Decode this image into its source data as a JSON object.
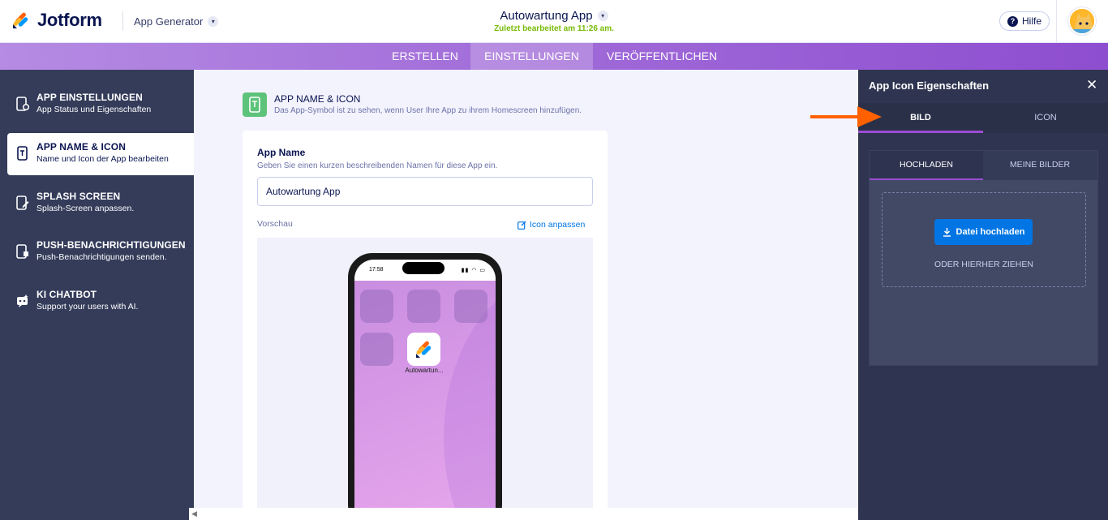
{
  "header": {
    "brand": "Jotform",
    "product": "App Generator",
    "app_title": "Autowartung App",
    "last_edited": "Zuletzt bearbeitet am 11:26 am.",
    "help_label": "Hilfe"
  },
  "nav": {
    "tabs": [
      {
        "label": "ERSTELLEN"
      },
      {
        "label": "EINSTELLUNGEN"
      },
      {
        "label": "VERÖFFENTLICHEN"
      }
    ],
    "active": "EINSTELLUNGEN"
  },
  "sidebar": {
    "items": [
      {
        "title": "APP EINSTELLUNGEN",
        "subtitle": "App Status und Eigenschaften"
      },
      {
        "title": "APP NAME & ICON",
        "subtitle": "Name und Icon der App bearbeiten"
      },
      {
        "title": "SPLASH SCREEN",
        "subtitle": "Splash-Screen anpassen."
      },
      {
        "title": "PUSH-BENACHRICHTIGUNGEN",
        "subtitle": "Push-Benachrichtigungen senden."
      },
      {
        "title": "KI CHATBOT",
        "subtitle": "Support your users with AI."
      }
    ],
    "active_index": 1
  },
  "main": {
    "section_title": "APP NAME & ICON",
    "section_subtitle": "Das App-Symbol ist zu sehen, wenn User Ihre App zu ihrem Homescreen hinzufügen.",
    "field_label": "App Name",
    "field_help": "Geben Sie einen kurzen beschreibenden Namen für diese App ein.",
    "field_value": "Autowartung App",
    "preview_label": "Vorschau",
    "customize_icon_label": "Icon anpassen",
    "phone": {
      "time": "17:58",
      "app_label": "Autowartun..."
    }
  },
  "panel": {
    "title": "App Icon Eigenschaften",
    "tabs": [
      {
        "label": "BILD"
      },
      {
        "label": "ICON"
      }
    ],
    "active_tab": "BILD",
    "inner_tabs": [
      {
        "label": "HOCHLADEN"
      },
      {
        "label": "MEINE BILDER"
      }
    ],
    "active_inner_tab": "HOCHLADEN",
    "upload_button": "Datei hochladen",
    "drag_text": "ODER HIERHER ZIEHEN"
  },
  "colors": {
    "accent_purple": "#9c4dd3",
    "primary_blue": "#0075e3",
    "sidebar_bg": "#343c5a",
    "panel_bg": "#2f3550",
    "annotation_orange": "#ff6100",
    "edited_green": "#78bb07"
  }
}
